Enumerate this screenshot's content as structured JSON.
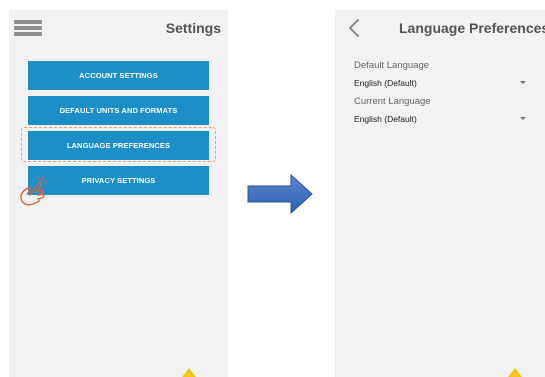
{
  "left_screen": {
    "title": "Settings",
    "buttons": [
      {
        "label": "ACCOUNT SETTINGS"
      },
      {
        "label": "DEFAULT UNITS AND FORMATS"
      },
      {
        "label": "LANGUAGE PREFERENCES"
      },
      {
        "label": "PRIVACY SETTINGS"
      }
    ],
    "highlighted_item": "LANGUAGE PREFERENCES",
    "icons": {
      "menu": "hamburger-menu-icon",
      "pointer": "tap-hand-icon",
      "corner": "warning-triangle-icon"
    }
  },
  "transition": {
    "icon": "right-arrow-icon",
    "color": "#3d6fc0"
  },
  "right_screen": {
    "title": "Language Preferences",
    "back_icon": "chevron-left-icon",
    "fields": [
      {
        "label": "Default Language",
        "value": "English (Default)"
      },
      {
        "label": "Current Language",
        "value": "English (Default)"
      }
    ]
  },
  "colors": {
    "button_bg": "#1d8fc8",
    "button_text": "#ffffff",
    "screen_bg": "#f2f2f2",
    "highlight_border": "#e8a07a",
    "warning": "#f3c61b"
  }
}
